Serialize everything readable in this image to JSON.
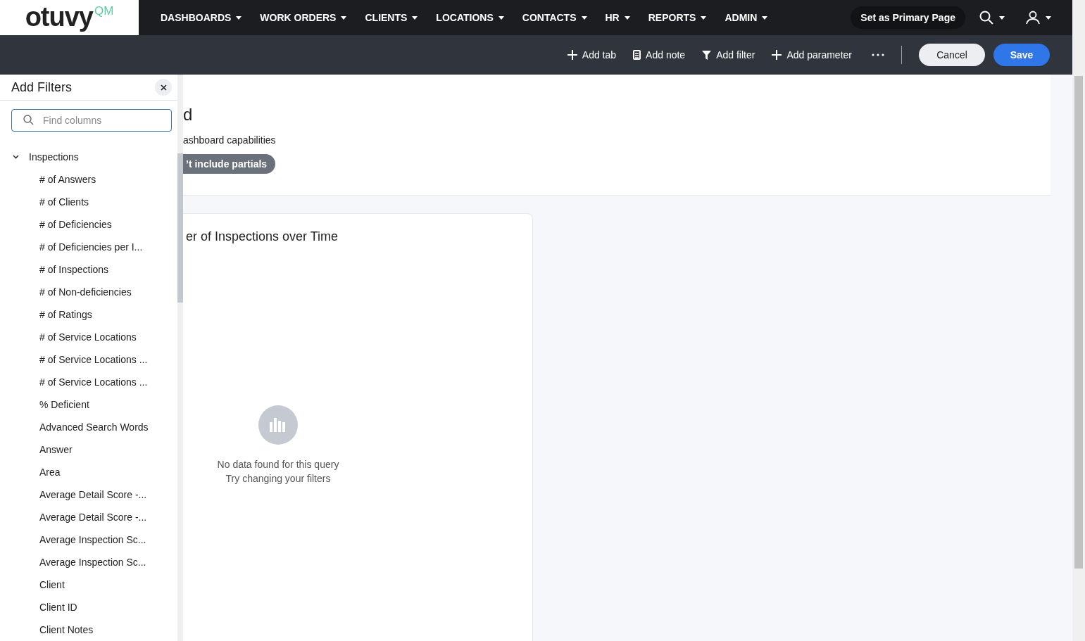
{
  "logo": {
    "text": "otuvy",
    "superscript": "QM"
  },
  "nav": [
    {
      "label": "DASHBOARDS"
    },
    {
      "label": "WORK ORDERS"
    },
    {
      "label": "CLIENTS"
    },
    {
      "label": "LOCATIONS"
    },
    {
      "label": "CONTACTS"
    },
    {
      "label": "HR"
    },
    {
      "label": "REPORTS"
    },
    {
      "label": "ADMIN"
    }
  ],
  "primary_page_button": "Set as Primary Page",
  "toolbar": {
    "actions": [
      {
        "kind": "plus",
        "label": "Add tab"
      },
      {
        "kind": "note",
        "label": "Add note"
      },
      {
        "kind": "filter",
        "label": "Add filter"
      },
      {
        "kind": "plus",
        "label": "Add parameter"
      }
    ],
    "cancel": "Cancel",
    "save": "Save"
  },
  "filter_panel": {
    "title": "Add Filters",
    "search": {
      "placeholder": "Find columns"
    },
    "tree": [
      {
        "label": "Inspections",
        "expanded": true,
        "children": [
          {
            "label": "# of Answers"
          },
          {
            "label": "# of Clients"
          },
          {
            "label": "# of Deficiencies"
          },
          {
            "label": "# of Deficiencies per I..."
          },
          {
            "label": "# of Inspections"
          },
          {
            "label": "# of Non-deficiencies"
          },
          {
            "label": "# of Ratings"
          },
          {
            "label": "# of Service Locations"
          },
          {
            "label": "# of Service Locations ..."
          },
          {
            "label": "# of Service Locations ..."
          },
          {
            "label": "% Deficient"
          },
          {
            "label": "Advanced Search Words"
          },
          {
            "label": "Answer"
          },
          {
            "label": "Area"
          },
          {
            "label": "Average Detail Score -..."
          },
          {
            "label": "Average Detail Score -..."
          },
          {
            "label": "Average Inspection Sc..."
          },
          {
            "label": "Average Inspection Sc..."
          },
          {
            "label": "Client"
          },
          {
            "label": "Client ID"
          },
          {
            "label": "Client Notes"
          }
        ]
      }
    ]
  },
  "header_card": {
    "title": "d",
    "description": "ashboard capabilities",
    "tag": "’t include partials"
  },
  "chart_card": {
    "title": "er of Inspections over Time",
    "empty_message": "No data found for this query",
    "empty_hint": "Try changing your filters"
  }
}
